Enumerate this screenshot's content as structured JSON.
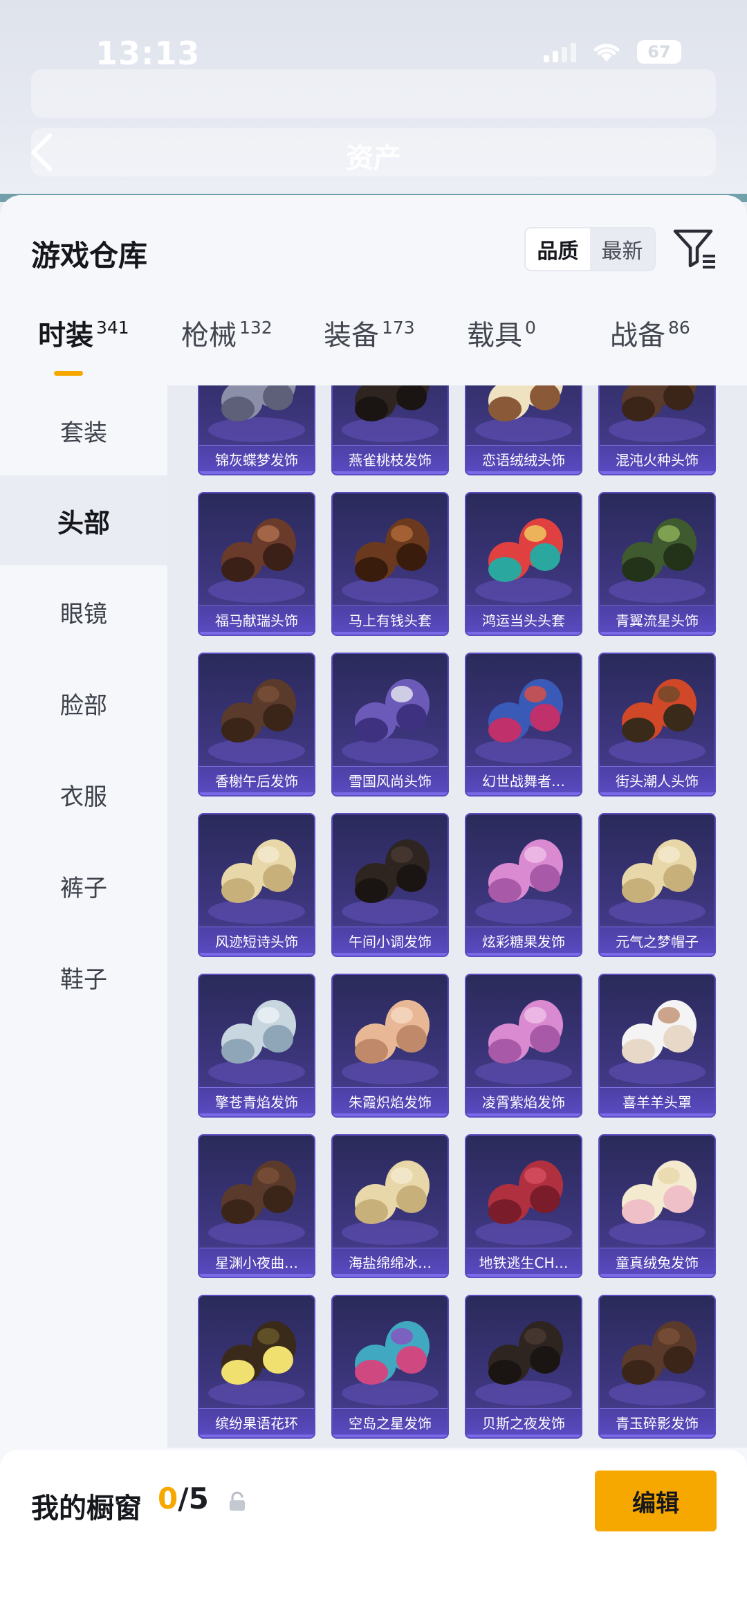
{
  "status_bar": {
    "time": "13:13",
    "battery": "67"
  },
  "header": {
    "title": "资产"
  },
  "sheet": {
    "title": "游戏仓库",
    "sort": {
      "quality": "品质",
      "newest": "最新",
      "selected": "quality"
    }
  },
  "tabs": [
    {
      "label": "时装",
      "count": "341",
      "active": true
    },
    {
      "label": "枪械",
      "count": "132",
      "active": false
    },
    {
      "label": "装备",
      "count": "173",
      "active": false
    },
    {
      "label": "载具",
      "count": "0",
      "active": false
    },
    {
      "label": "战备",
      "count": "86",
      "active": false
    }
  ],
  "sidebar": {
    "items": [
      {
        "label": "套装",
        "active": false
      },
      {
        "label": "头部",
        "active": true
      },
      {
        "label": "眼镜",
        "active": false
      },
      {
        "label": "脸部",
        "active": false
      },
      {
        "label": "衣服",
        "active": false
      },
      {
        "label": "裤子",
        "active": false
      },
      {
        "label": "鞋子",
        "active": false
      }
    ]
  },
  "items": [
    {
      "name": "锦灰蝶梦发饰",
      "art": "hair-grey"
    },
    {
      "name": "燕雀桃枝发饰",
      "art": "hair-dark"
    },
    {
      "name": "恋语绒绒头饰",
      "art": "hat-cream"
    },
    {
      "name": "混沌火种头饰",
      "art": "hair-brown"
    },
    {
      "name": "福马献瑞头饰",
      "art": "horse-mini"
    },
    {
      "name": "马上有钱头套",
      "art": "horse-mask"
    },
    {
      "name": "鸿运当头头套",
      "art": "dragon-mask"
    },
    {
      "name": "青翼流星头饰",
      "art": "hair-green"
    },
    {
      "name": "香榭午后发饰",
      "art": "hair-brown"
    },
    {
      "name": "雪国风尚头饰",
      "art": "hair-purple"
    },
    {
      "name": "幻世战舞者…",
      "art": "bucket-hat"
    },
    {
      "name": "街头潮人头饰",
      "art": "beanie-red"
    },
    {
      "name": "风迹短诗头饰",
      "art": "hair-blonde"
    },
    {
      "name": "午间小调发饰",
      "art": "hair-dark"
    },
    {
      "name": "炫彩糖果发饰",
      "art": "hair-pink"
    },
    {
      "name": "元气之梦帽子",
      "art": "hair-blonde"
    },
    {
      "name": "擎苍青焰发饰",
      "art": "hair-silver"
    },
    {
      "name": "朱霞炽焰发饰",
      "art": "hair-peach"
    },
    {
      "name": "凌霄紫焰发饰",
      "art": "hair-pink"
    },
    {
      "name": "喜羊羊头罩",
      "art": "sheep-mask"
    },
    {
      "name": "星渊小夜曲…",
      "art": "hair-brown"
    },
    {
      "name": "海盐绵绵冰…",
      "art": "hair-blonde"
    },
    {
      "name": "地铁逃生CH…",
      "art": "hair-red"
    },
    {
      "name": "童真绒兔发饰",
      "art": "bunny"
    },
    {
      "name": "缤纷果语花环",
      "art": "flower-crown"
    },
    {
      "name": "空岛之星发饰",
      "art": "masks-color"
    },
    {
      "name": "贝斯之夜发饰",
      "art": "hair-dark"
    },
    {
      "name": "青玉碎影发饰",
      "art": "hair-brown"
    }
  ],
  "showcase": {
    "label": "我的橱窗",
    "current": "0",
    "total": "/5",
    "edit_label": "编辑"
  },
  "colors": {
    "accent": "#f6a800",
    "card_bg": "#3a3478",
    "card_border": "#5b4cc0"
  }
}
